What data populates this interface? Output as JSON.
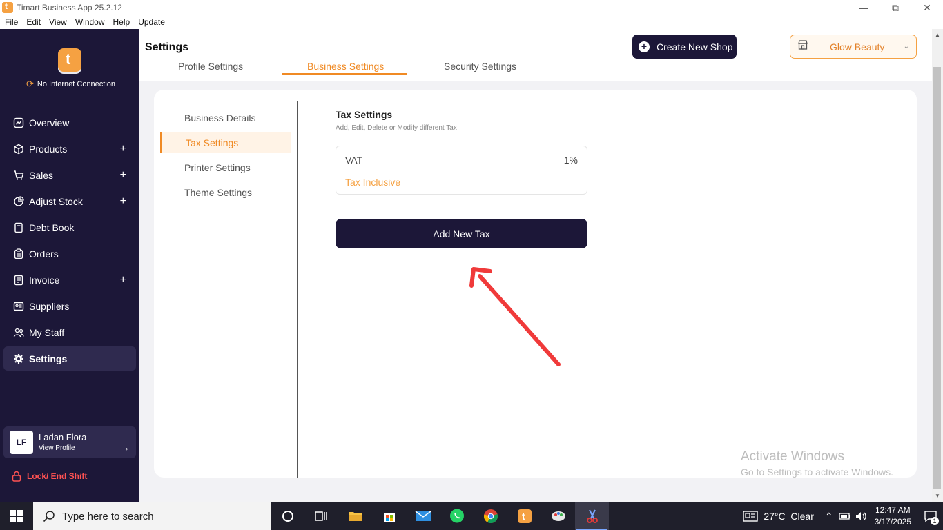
{
  "window": {
    "title": "Timart Business App 25.2.12"
  },
  "menu": [
    "File",
    "Edit",
    "View",
    "Window",
    "Help",
    "Update"
  ],
  "sidebar": {
    "connection": "No Internet Connection",
    "items": [
      {
        "label": "Overview",
        "icon": "chart-icon",
        "expandable": false
      },
      {
        "label": "Products",
        "icon": "box-icon",
        "expandable": true
      },
      {
        "label": "Sales",
        "icon": "cart-icon",
        "expandable": true
      },
      {
        "label": "Adjust Stock",
        "icon": "pie-icon",
        "expandable": true
      },
      {
        "label": "Debt Book",
        "icon": "book-icon",
        "expandable": false
      },
      {
        "label": "Orders",
        "icon": "clipboard-icon",
        "expandable": false
      },
      {
        "label": "Invoice",
        "icon": "invoice-icon",
        "expandable": true
      },
      {
        "label": "Suppliers",
        "icon": "id-card-icon",
        "expandable": false
      },
      {
        "label": "My Staff",
        "icon": "people-icon",
        "expandable": false
      },
      {
        "label": "Settings",
        "icon": "gear-icon",
        "expandable": false,
        "active": true
      }
    ],
    "profile": {
      "initials": "LF",
      "name": "Ladan Flora",
      "link": "View Profile"
    },
    "lock": "Lock/ End Shift"
  },
  "header": {
    "title": "Settings",
    "tabs": [
      "Profile Settings",
      "Business Settings",
      "Security Settings"
    ],
    "active_tab": "Business Settings",
    "create_shop": "Create New Shop",
    "shop": "Glow Beauty"
  },
  "business": {
    "nav": [
      "Business Details",
      "Tax Settings",
      "Printer Settings",
      "Theme Settings"
    ],
    "active": "Tax Settings",
    "tax": {
      "title": "Tax Settings",
      "subtitle": "Add, Edit, Delete or Modify different Tax",
      "entries": [
        {
          "name": "VAT",
          "rate": "1%",
          "type": "Tax Inclusive"
        }
      ],
      "add_button": "Add New Tax"
    }
  },
  "watermark": {
    "line1": "Activate Windows",
    "line2": "Go to Settings to activate Windows."
  },
  "taskbar": {
    "search_placeholder": "Type here to search",
    "weather": "27°C  Clear",
    "time": "12:47 AM",
    "date": "3/17/2025",
    "notifications": "1"
  },
  "colors": {
    "accent": "#f08a24",
    "sidebar": "#1c1738",
    "annotation_arrow": "#f03a3a"
  }
}
